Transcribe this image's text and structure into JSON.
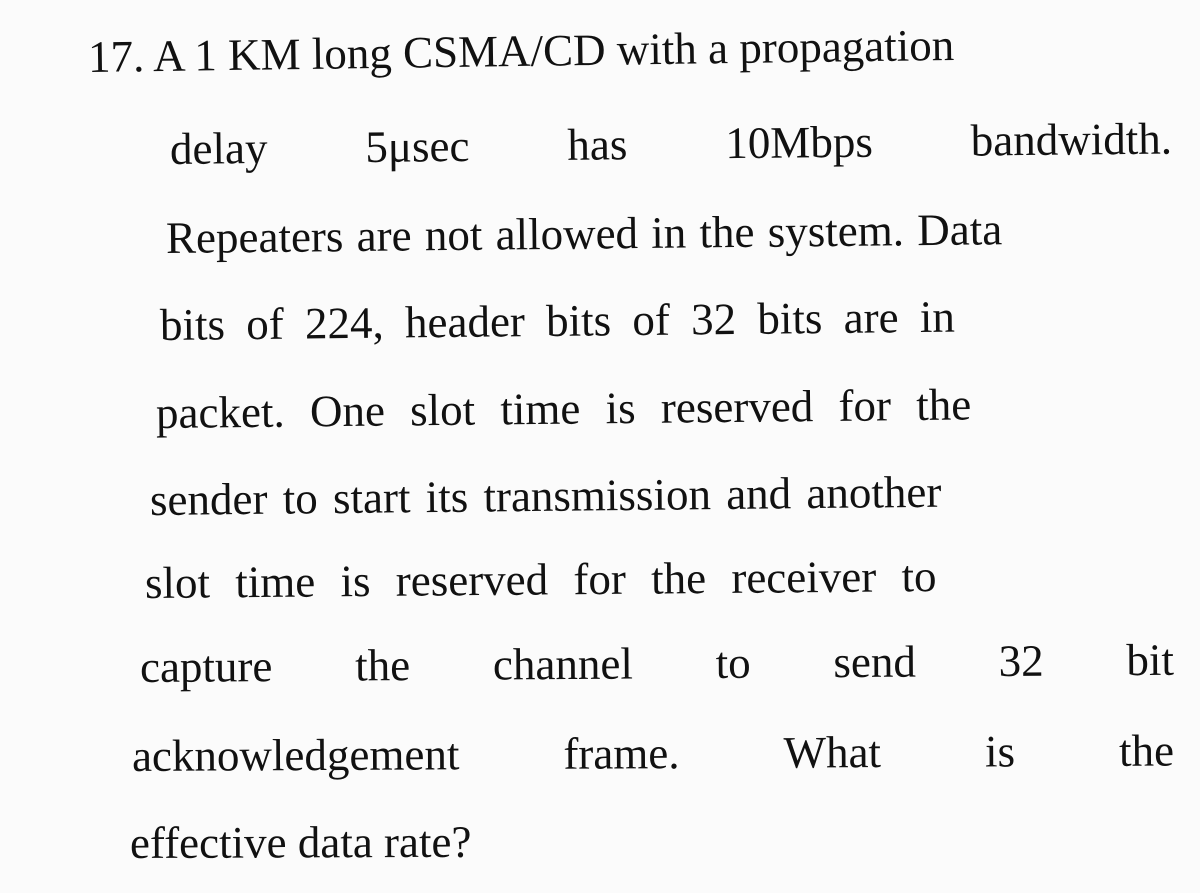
{
  "question": {
    "number": "17.",
    "lines": [
      [
        "17. A 1 KM long CSMA/CD with a propagation"
      ],
      [
        "delay",
        "5μsec",
        "has",
        "10Mbps",
        "bandwidth."
      ],
      [
        "Repeaters are not allowed in the system. Data"
      ],
      [
        "bits of 224, header bits of 32 bits are in"
      ],
      [
        "packet. One slot time is reserved for the"
      ],
      [
        "sender to start its transmission and another"
      ],
      [
        "slot time is reserved for the receiver to"
      ],
      [
        "capture",
        "the",
        "channel",
        "to",
        "send",
        "32",
        "bit"
      ],
      [
        "acknowledgement",
        "frame.",
        "What",
        "is",
        "the"
      ],
      [
        "effective data rate?"
      ]
    ]
  }
}
